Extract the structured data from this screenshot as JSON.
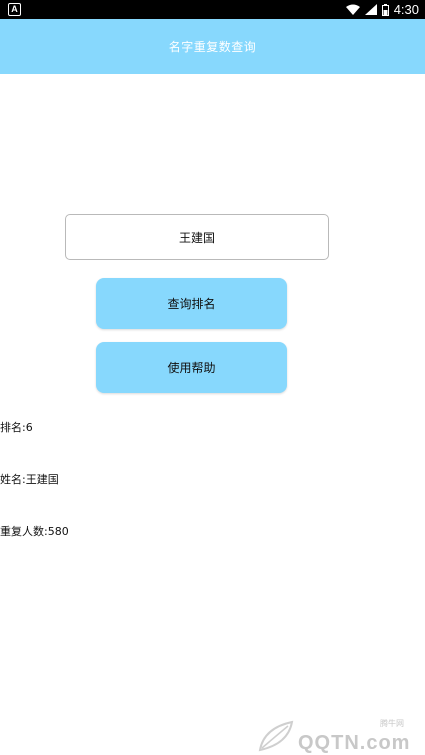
{
  "status_bar": {
    "left_icon": "A",
    "time": "4:30"
  },
  "app_bar": {
    "title": "名字重复数查询"
  },
  "search": {
    "value": "王建国"
  },
  "buttons": {
    "query_label": "查询排名",
    "help_label": "使用帮助"
  },
  "results": {
    "rank": "排名:6",
    "name": "姓名:王建国",
    "duplicate_count": "重复人数:580"
  },
  "watermark": {
    "text": "QQTN.com",
    "sub": "腾牛网"
  },
  "colors": {
    "accent": "#87d8fd",
    "status_bar": "#000000",
    "background": "#ffffff"
  },
  "icons": {
    "status_left": "notification-a-icon",
    "wifi": "wifi-icon",
    "signal": "cell-signal-icon",
    "battery": "battery-icon"
  }
}
